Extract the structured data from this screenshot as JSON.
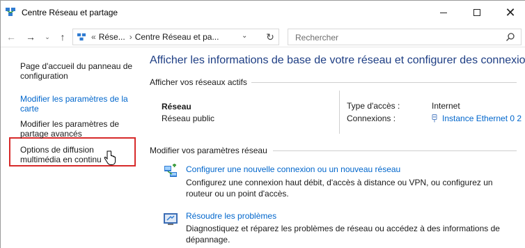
{
  "window": {
    "title": "Centre Réseau et partage",
    "controls": {
      "minimize": "minimize-icon",
      "maximize": "maximize-icon",
      "close": "✕"
    }
  },
  "address_bar": {
    "overflow": "«",
    "crumbs": [
      "Rése...",
      "Centre Réseau et pa..."
    ],
    "separator": "›",
    "dropdown": "⌄",
    "refresh": "↻"
  },
  "search": {
    "placeholder": "Rechercher"
  },
  "sidebar": {
    "items": [
      {
        "label": "Page d'accueil du panneau de configuration"
      },
      {
        "label": "Modifier les paramètres de la carte"
      },
      {
        "label": "Modifier les paramètres de partage avancés"
      },
      {
        "label": "Options de diffusion multimédia en continu"
      }
    ]
  },
  "main": {
    "title": "Afficher les informations de base de votre réseau et configurer des connexions",
    "active_networks_label": "Afficher vos réseaux actifs",
    "network": {
      "name": "Réseau",
      "type": "Réseau public",
      "access_type_label": "Type d'accès :",
      "access_type_value": "Internet",
      "connections_label": "Connexions :",
      "connections_value": "Instance Ethernet 0 2"
    },
    "modify_label": "Modifier vos paramètres réseau",
    "tasks": [
      {
        "link": "Configurer une nouvelle connexion ou un nouveau réseau",
        "desc": "Configurez une connexion haut débit, d'accès à distance ou VPN, ou configurez un routeur ou un point d'accès."
      },
      {
        "link": "Résoudre les problèmes",
        "desc": "Diagnostiquez et réparez les problèmes de réseau ou accédez à des informations de dépannage."
      }
    ]
  },
  "colors": {
    "link": "#0066cc",
    "title": "#1e3e84",
    "highlight": "#d72a2a"
  }
}
